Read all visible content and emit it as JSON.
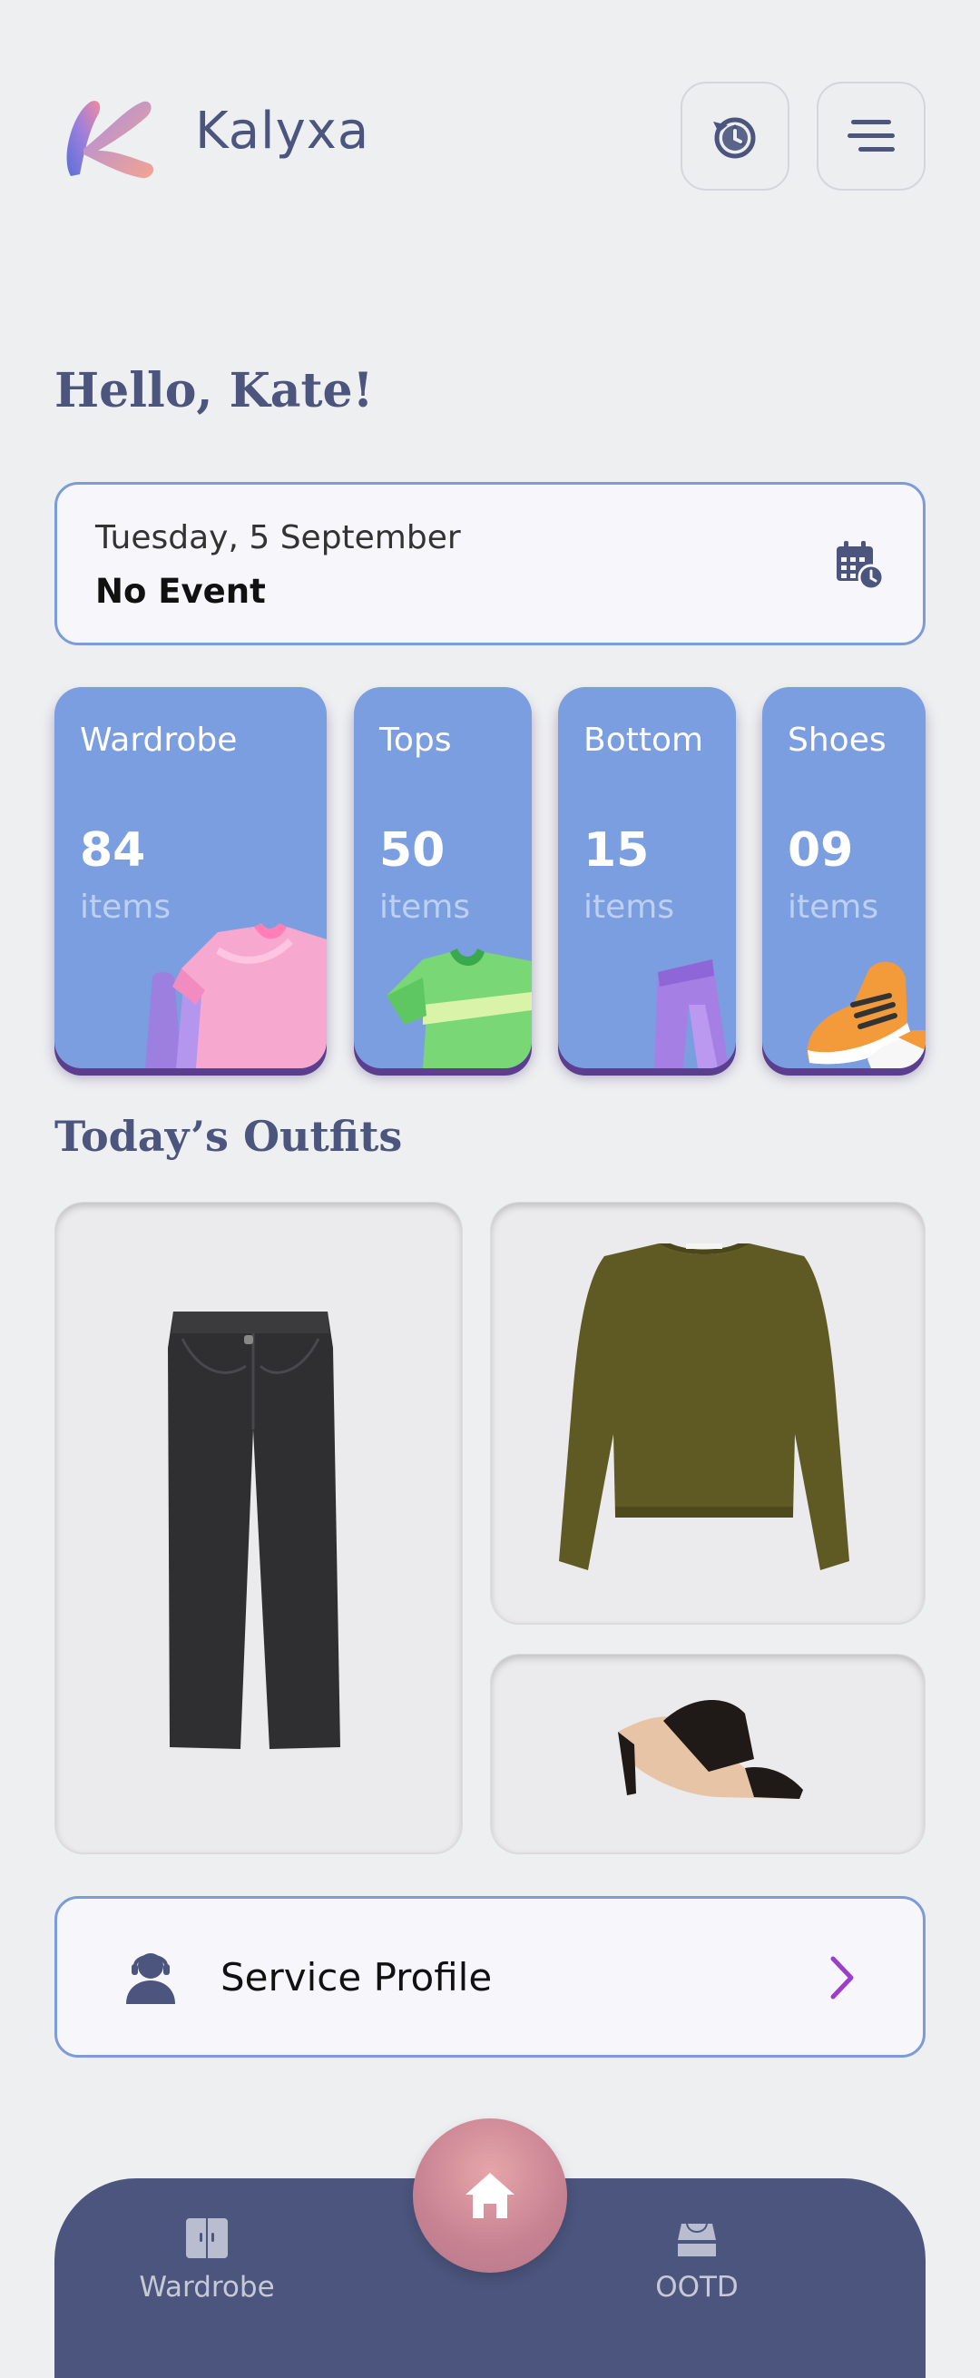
{
  "header": {
    "app_name": "Kalyxa",
    "history_icon": "history-icon",
    "menu_icon": "menu-icon"
  },
  "greeting": "Hello, Kate!",
  "date_card": {
    "date": "Tuesday, 5 September",
    "event": "No Event",
    "icon": "calendar-clock-icon"
  },
  "categories": [
    {
      "name": "Wardrobe",
      "count": "84",
      "unit": "items"
    },
    {
      "name": "Tops",
      "count": "50",
      "unit": "items"
    },
    {
      "name": "Bottom",
      "count": "15",
      "unit": "items"
    },
    {
      "name": "Shoes",
      "count": "09",
      "unit": "items"
    }
  ],
  "outfits": {
    "title": "Today’s Outfits",
    "items": [
      "jeans-image",
      "sweater-image",
      "sandal-image"
    ]
  },
  "service_profile": {
    "label": "Service Profile",
    "icon": "support-agent-icon"
  },
  "nav": {
    "wardrobe_label": "Wardrobe",
    "ootd_label": "OOTD",
    "home_icon": "home-icon"
  },
  "colors": {
    "primary": "#4b557d",
    "card_blue": "#7a9edf",
    "accent_purple": "#9b3fc9",
    "home_pink": "#c78292"
  }
}
